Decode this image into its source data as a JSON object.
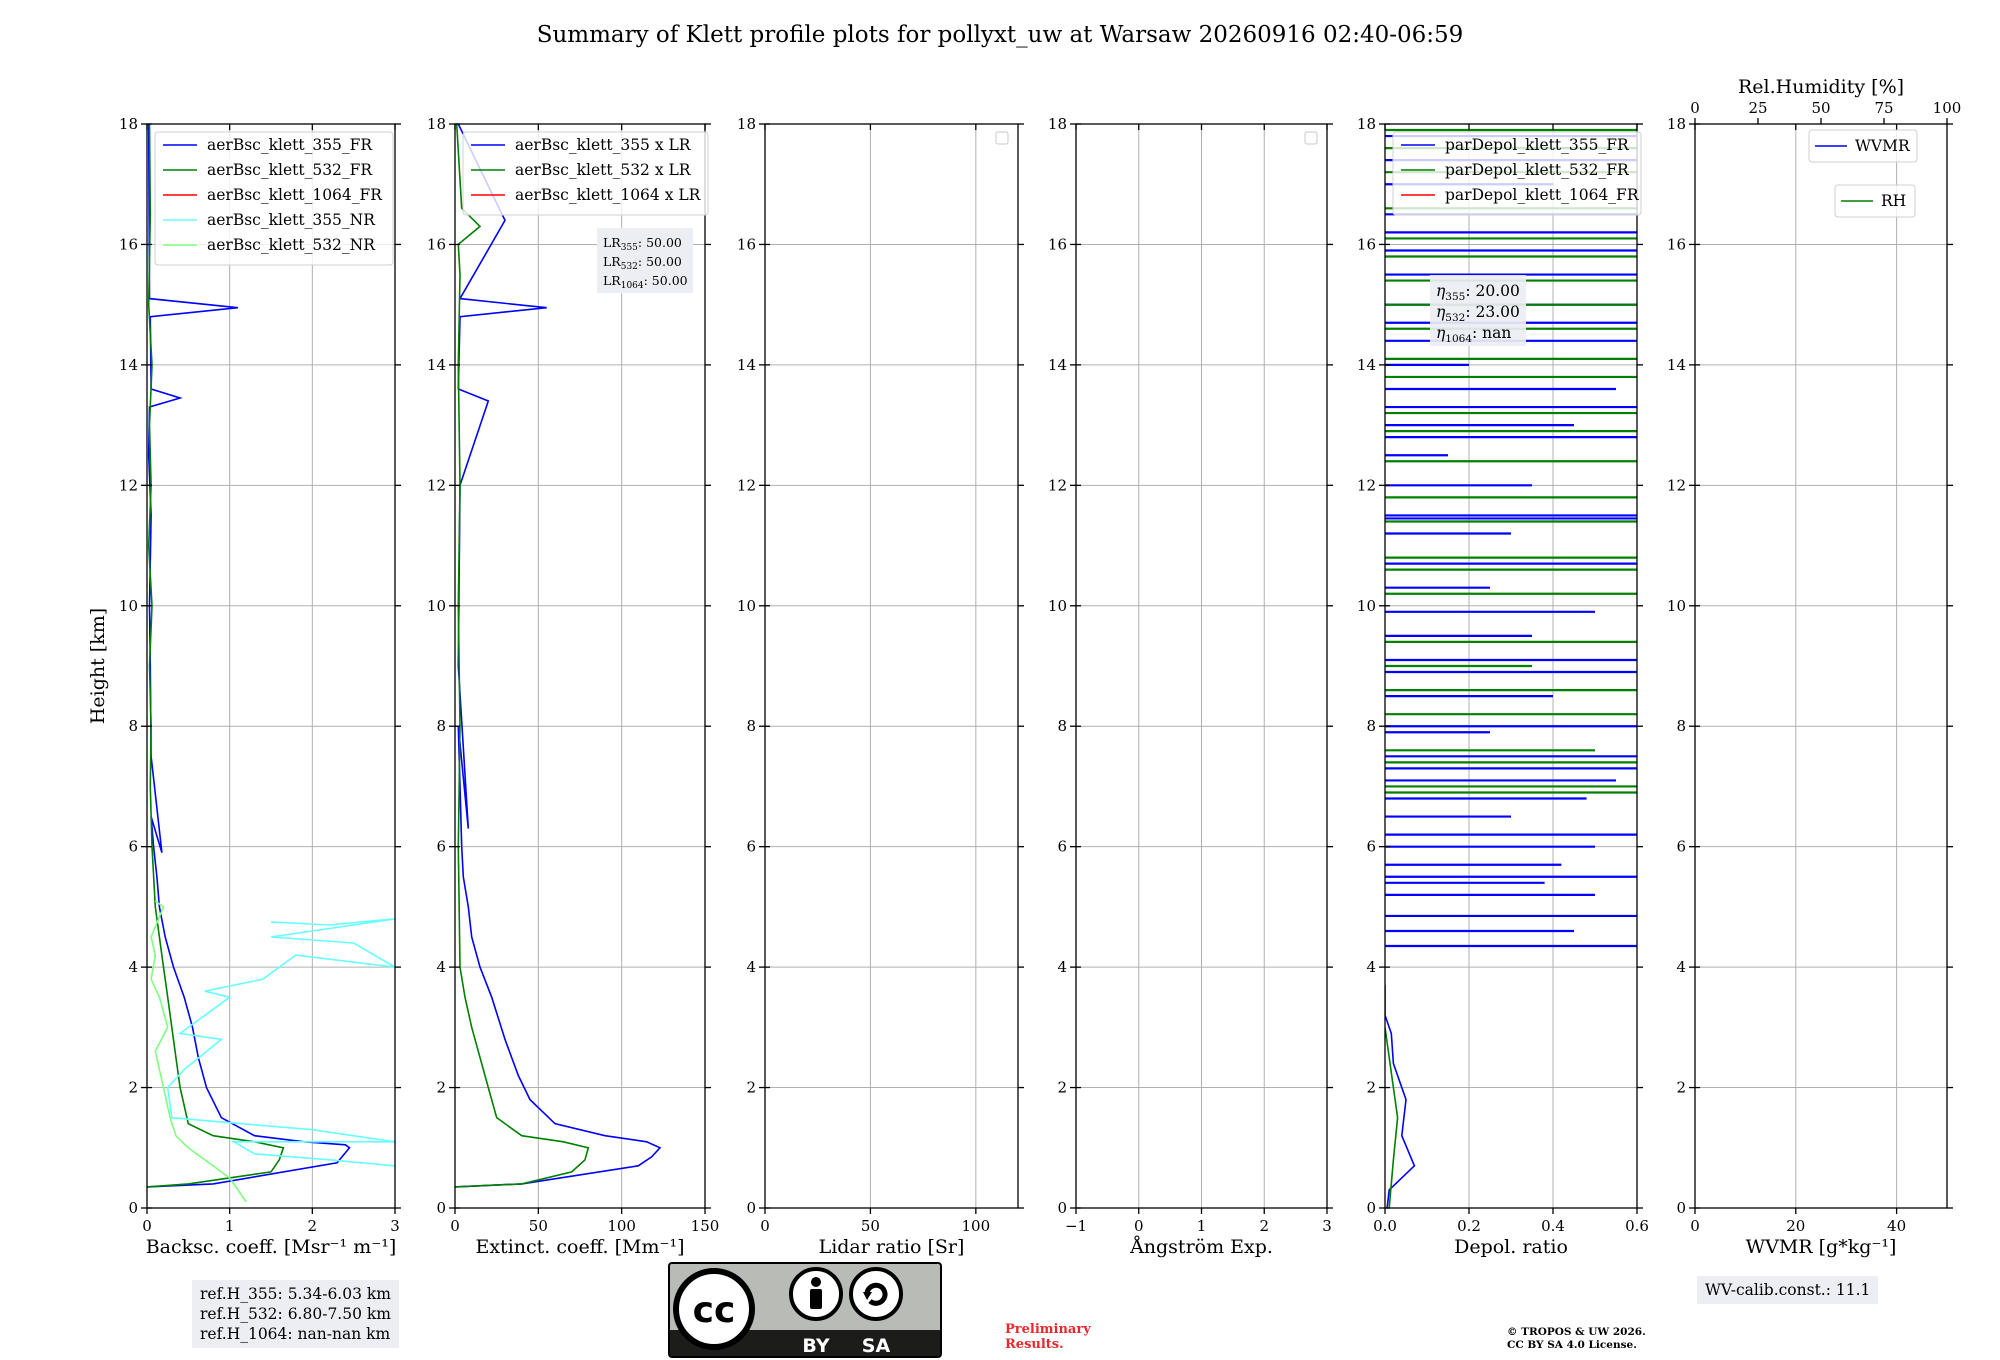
{
  "figure": {
    "title": "Summary of Klett profile plots for pollyxt_uw at Warsaw 20260916 02:40-06:59",
    "ylabel": "Height [km]"
  },
  "chart_data": [
    {
      "type": "line",
      "panel": "backscatter",
      "xlabel": "Backsc. coeff. [Msr⁻¹ m⁻¹]",
      "xlim": [
        0,
        3
      ],
      "ylim": [
        0,
        18
      ],
      "xticks": [
        "0",
        "1",
        "2",
        "3"
      ],
      "yticks": [
        "0",
        "2",
        "4",
        "6",
        "8",
        "10",
        "12",
        "14",
        "16",
        "18"
      ],
      "grid": true,
      "legend": "top-left",
      "series": [
        {
          "name": "aerBsc_klett_355_FR",
          "color": "#0000ff",
          "x": [
            0.0,
            0.8,
            2.3,
            2.45,
            2.4,
            1.9,
            1.3,
            0.9,
            0.72,
            0.62,
            0.55,
            0.45,
            0.32,
            0.22,
            0.15,
            0.12,
            0.08,
            0.05,
            0.18,
            0.05,
            0.04,
            0.03,
            0.05,
            0.02,
            0.03,
            0.4,
            0.05,
            0.04,
            1.1,
            0.03,
            0.02
          ],
          "y": [
            0.35,
            0.4,
            0.75,
            1.0,
            1.05,
            1.1,
            1.2,
            1.5,
            2.0,
            2.5,
            3.0,
            3.5,
            4.0,
            4.5,
            5.0,
            5.5,
            6.0,
            6.5,
            5.9,
            7.5,
            9.0,
            10.0,
            11.5,
            12.5,
            13.3,
            13.45,
            13.6,
            14.8,
            14.95,
            15.1,
            18.0
          ]
        },
        {
          "name": "aerBsc_klett_532_FR",
          "color": "#008000",
          "x": [
            0.0,
            0.5,
            1.5,
            1.6,
            1.65,
            1.3,
            0.8,
            0.5,
            0.4,
            0.35,
            0.3,
            0.25,
            0.2,
            0.15,
            0.1,
            0.06,
            0.04,
            0.05,
            0.03,
            0.06,
            0.02,
            0.05,
            0.03,
            0.06,
            0.02,
            0.04,
            0.03
          ],
          "y": [
            0.35,
            0.4,
            0.6,
            0.8,
            1.0,
            1.1,
            1.2,
            1.4,
            2.0,
            2.5,
            3.0,
            3.5,
            4.0,
            4.5,
            5.0,
            6.0,
            7.0,
            8.0,
            9.0,
            10.0,
            11.0,
            12.0,
            13.0,
            14.0,
            15.0,
            16.5,
            18.0
          ]
        },
        {
          "name": "aerBsc_klett_1064_FR",
          "color": "#ff0000",
          "x": [],
          "y": []
        },
        {
          "name": "aerBsc_klett_355_NR",
          "color": "#66ffff",
          "x": [
            3.0,
            2.2,
            1.3,
            1.05,
            3.0,
            2.0,
            0.3,
            0.25,
            0.45,
            0.9,
            0.4,
            0.7,
            1.0,
            0.7,
            1.4,
            1.8,
            3.0,
            2.5,
            1.5,
            3.0,
            2.2,
            1.5
          ],
          "y": [
            0.7,
            0.8,
            0.9,
            1.1,
            1.1,
            1.3,
            1.5,
            2.0,
            2.3,
            2.8,
            2.9,
            3.2,
            3.5,
            3.6,
            3.8,
            4.2,
            4.0,
            4.4,
            4.5,
            4.8,
            4.7,
            4.75
          ]
        },
        {
          "name": "aerBsc_klett_532_NR",
          "color": "#80ff80",
          "x": [
            1.2,
            1.15,
            1.0,
            0.8,
            0.5,
            0.35,
            0.28,
            0.2,
            0.1,
            0.25,
            0.15,
            0.05,
            0.1,
            0.05,
            0.2,
            0.1
          ],
          "y": [
            0.1,
            0.2,
            0.5,
            0.7,
            1.0,
            1.2,
            1.5,
            2.0,
            2.6,
            3.0,
            3.5,
            3.8,
            4.2,
            4.5,
            5.0,
            5.1
          ]
        }
      ],
      "annotations": [
        "ref.H_355: 5.34-6.03 km",
        "ref.H_532: 6.80-7.50 km",
        "ref.H_1064: nan-nan km"
      ]
    },
    {
      "type": "line",
      "panel": "extinction",
      "xlabel": "Extinct. coeff. [Mm⁻¹]",
      "xlim": [
        0,
        150
      ],
      "ylim": [
        0,
        18
      ],
      "xticks": [
        "0",
        "50",
        "100",
        "150"
      ],
      "yticks": [
        "0",
        "2",
        "4",
        "6",
        "8",
        "10",
        "12",
        "14",
        "16",
        "18"
      ],
      "grid": true,
      "legend": "top-left",
      "series": [
        {
          "name": "aerBsc_klett_355 x LR",
          "color": "#0000ff",
          "x": [
            0.0,
            40.0,
            110.0,
            118.0,
            123.0,
            115.0,
            90.0,
            60.0,
            45.0,
            38.0,
            30.0,
            22.0,
            15.0,
            10.0,
            8.0,
            5.0,
            4.0,
            3.0,
            2.0,
            8.0,
            2.0,
            3.0,
            20.0,
            2.0,
            3.0,
            55.0,
            3.0,
            30.0,
            2.0
          ],
          "y": [
            0.35,
            0.4,
            0.7,
            0.85,
            1.0,
            1.1,
            1.2,
            1.4,
            1.8,
            2.2,
            2.8,
            3.5,
            4.0,
            4.5,
            5.0,
            5.5,
            6.0,
            7.0,
            8.0,
            6.3,
            9.0,
            12.0,
            13.4,
            13.6,
            14.8,
            14.95,
            15.1,
            16.4,
            18.0
          ]
        },
        {
          "name": "aerBsc_klett_532 x LR",
          "color": "#008000",
          "x": [
            0.0,
            40.0,
            70.0,
            78.0,
            80.0,
            65.0,
            40.0,
            25.0,
            20.0,
            15.0,
            10.0,
            6.0,
            3.0,
            2.0,
            3.0,
            2.0,
            3.0,
            2.0,
            3.0,
            2.0,
            15.0,
            4.0,
            1.0
          ],
          "y": [
            0.35,
            0.4,
            0.6,
            0.8,
            1.0,
            1.1,
            1.2,
            1.5,
            2.0,
            2.5,
            3.0,
            3.5,
            4.0,
            6.0,
            8.0,
            10.0,
            12.0,
            14.0,
            15.5,
            16.0,
            16.3,
            16.6,
            18.0
          ]
        },
        {
          "name": "aerBsc_klett_1064 x LR",
          "color": "#ff0000",
          "x": [],
          "y": []
        }
      ],
      "annotations": [
        "LR355: 50.00",
        "LR532: 50.00",
        "LR1064: 50.00"
      ]
    },
    {
      "type": "line",
      "panel": "lidar-ratio",
      "xlabel": "Lidar ratio [Sr]",
      "xlim": [
        0,
        120
      ],
      "ylim": [
        0,
        18
      ],
      "xticks": [
        "0",
        "50",
        "100"
      ],
      "yticks": [
        "0",
        "2",
        "4",
        "6",
        "8",
        "10",
        "12",
        "14",
        "16",
        "18"
      ],
      "grid": true,
      "legend": "top-right",
      "series": []
    },
    {
      "type": "line",
      "panel": "angstrom",
      "xlabel": "Ångström Exp.",
      "xlim": [
        -1,
        3
      ],
      "ylim": [
        0,
        18
      ],
      "xticks": [
        "−1",
        "0",
        "1",
        "2",
        "3"
      ],
      "yticks": [
        "0",
        "2",
        "4",
        "6",
        "8",
        "10",
        "12",
        "14",
        "16",
        "18"
      ],
      "grid": true,
      "legend": "top-right",
      "series": []
    },
    {
      "type": "line",
      "panel": "depolarization",
      "xlabel": "Depol. ratio",
      "xlim": [
        0,
        0.6
      ],
      "ylim": [
        0,
        18
      ],
      "xticks": [
        "0.0",
        "0.2",
        "0.4",
        "0.6"
      ],
      "yticks": [
        "0",
        "2",
        "4",
        "6",
        "8",
        "10",
        "12",
        "14",
        "16",
        "18"
      ],
      "grid": true,
      "legend": "top-left",
      "series": [
        {
          "name": "parDepol_klett_355_FR",
          "color": "#0000ff",
          "x": [
            0.005,
            0.01,
            0.07,
            0.04,
            0.05,
            0.02,
            0.015,
            0.0,
            0.0,
            0.0,
            0.0
          ],
          "y": [
            0.0,
            0.3,
            0.7,
            1.2,
            1.8,
            2.4,
            2.9,
            3.2,
            3.5,
            3.6,
            3.7
          ],
          "spikes": [
            [
              4.35,
              0.6
            ],
            [
              4.6,
              0.45
            ],
            [
              4.85,
              0.6
            ],
            [
              5.2,
              0.5
            ],
            [
              5.4,
              0.38
            ],
            [
              5.5,
              0.6
            ],
            [
              5.7,
              0.42
            ],
            [
              6.0,
              0.5
            ],
            [
              6.2,
              0.6
            ],
            [
              6.5,
              0.3
            ],
            [
              6.8,
              0.48
            ],
            [
              7.1,
              0.55
            ],
            [
              7.3,
              0.6
            ],
            [
              7.5,
              0.6
            ],
            [
              7.9,
              0.25
            ],
            [
              8.0,
              0.6
            ],
            [
              8.5,
              0.4
            ],
            [
              8.9,
              0.6
            ],
            [
              9.1,
              0.6
            ],
            [
              9.5,
              0.35
            ],
            [
              9.9,
              0.5
            ],
            [
              10.3,
              0.25
            ],
            [
              10.7,
              0.6
            ],
            [
              11.2,
              0.3
            ],
            [
              11.45,
              0.6
            ],
            [
              11.5,
              0.6
            ],
            [
              12.0,
              0.35
            ],
            [
              12.5,
              0.15
            ],
            [
              12.8,
              0.6
            ],
            [
              13.0,
              0.45
            ],
            [
              13.3,
              0.6
            ],
            [
              13.6,
              0.55
            ],
            [
              14.0,
              0.2
            ],
            [
              14.4,
              0.6
            ],
            [
              14.7,
              0.6
            ],
            [
              15.0,
              0.6
            ],
            [
              15.5,
              0.6
            ],
            [
              15.9,
              0.6
            ],
            [
              16.2,
              0.6
            ],
            [
              16.5,
              0.6
            ],
            [
              17.0,
              0.4
            ],
            [
              17.4,
              0.6
            ],
            [
              17.8,
              0.6
            ]
          ]
        },
        {
          "name": "parDepol_klett_532_FR",
          "color": "#008000",
          "x": [
            0.01,
            0.02,
            0.03,
            0.02,
            0.01,
            0.0
          ],
          "y": [
            0.0,
            0.8,
            1.5,
            2.0,
            2.5,
            3.0
          ],
          "spikes": [
            [
              6.9,
              0.6
            ],
            [
              7.0,
              0.6
            ],
            [
              7.4,
              0.6
            ],
            [
              7.6,
              0.5
            ],
            [
              8.2,
              0.6
            ],
            [
              8.6,
              0.6
            ],
            [
              9.0,
              0.35
            ],
            [
              9.4,
              0.6
            ],
            [
              10.2,
              0.6
            ],
            [
              10.6,
              0.6
            ],
            [
              10.8,
              0.6
            ],
            [
              11.4,
              0.6
            ],
            [
              11.8,
              0.6
            ],
            [
              12.4,
              0.6
            ],
            [
              12.9,
              0.6
            ],
            [
              13.2,
              0.6
            ],
            [
              13.8,
              0.6
            ],
            [
              14.1,
              0.6
            ],
            [
              14.6,
              0.6
            ],
            [
              15.0,
              0.6
            ],
            [
              15.4,
              0.6
            ],
            [
              15.8,
              0.6
            ],
            [
              16.1,
              0.6
            ],
            [
              16.6,
              0.6
            ],
            [
              17.2,
              0.6
            ],
            [
              17.6,
              0.6
            ],
            [
              17.9,
              0.6
            ]
          ]
        },
        {
          "name": "parDepol_klett_1064_FR",
          "color": "#ff0000",
          "x": [],
          "y": []
        }
      ],
      "annotations": [
        "η355: 20.00",
        "η532: 23.00",
        "η1064: nan"
      ]
    },
    {
      "type": "line",
      "panel": "wvmr",
      "xlabel": "WVMR [g*kg⁻¹]",
      "xlabel_top": "Rel.Humidity [%]",
      "xlim": [
        0,
        50
      ],
      "xlim_top": [
        0,
        100
      ],
      "ylim": [
        0,
        18
      ],
      "xticks": [
        "0",
        "20",
        "40"
      ],
      "xticks_top": [
        "0",
        "25",
        "50",
        "75",
        "100"
      ],
      "yticks": [
        "0",
        "2",
        "4",
        "6",
        "8",
        "10",
        "12",
        "14",
        "16",
        "18"
      ],
      "grid": true,
      "legend": "top-right",
      "series": [
        {
          "name": "WVMR",
          "color": "#0000ff",
          "x": [],
          "y": []
        },
        {
          "name": "RH",
          "color": "#008000",
          "x": [],
          "y": []
        }
      ],
      "annotations": [
        "WV-calib.const.: 11.1"
      ]
    }
  ],
  "footer": {
    "refh": [
      "ref.H_355: 5.34-6.03 km",
      "ref.H_532: 6.80-7.50 km",
      "ref.H_1064: nan-nan km"
    ],
    "cc_by": "BY",
    "cc_sa": "SA",
    "preliminary": [
      "Preliminary",
      "Results."
    ],
    "copyright": [
      "© TROPOS & UW 2026.",
      "CC BY SA 4.0 License."
    ],
    "wv_calib": "WV-calib.const.: 11.1"
  }
}
